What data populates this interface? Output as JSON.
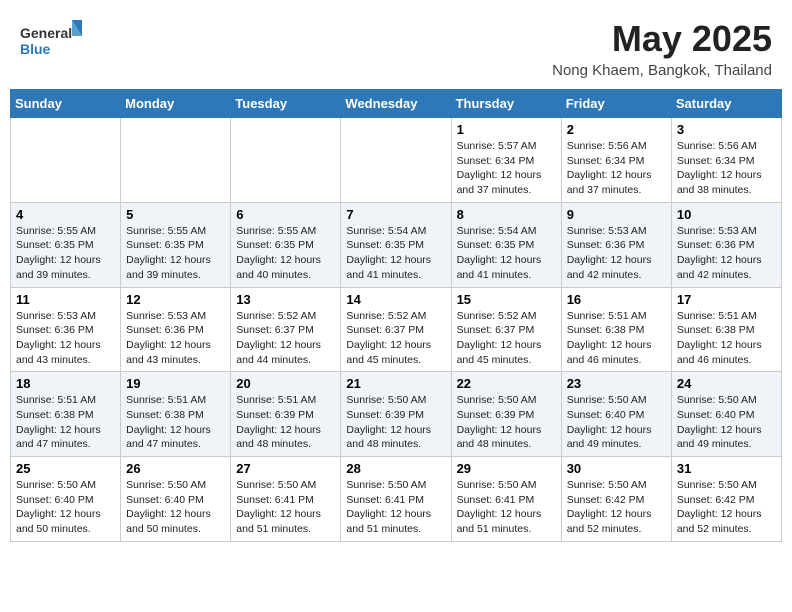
{
  "header": {
    "logo_general": "General",
    "logo_blue": "Blue",
    "month_year": "May 2025",
    "location": "Nong Khaem, Bangkok, Thailand"
  },
  "weekdays": [
    "Sunday",
    "Monday",
    "Tuesday",
    "Wednesday",
    "Thursday",
    "Friday",
    "Saturday"
  ],
  "weeks": [
    [
      {
        "day": "",
        "sunrise": "",
        "sunset": "",
        "daylight": ""
      },
      {
        "day": "",
        "sunrise": "",
        "sunset": "",
        "daylight": ""
      },
      {
        "day": "",
        "sunrise": "",
        "sunset": "",
        "daylight": ""
      },
      {
        "day": "",
        "sunrise": "",
        "sunset": "",
        "daylight": ""
      },
      {
        "day": "1",
        "sunrise": "5:57 AM",
        "sunset": "6:34 PM",
        "daylight": "12 hours and 37 minutes."
      },
      {
        "day": "2",
        "sunrise": "5:56 AM",
        "sunset": "6:34 PM",
        "daylight": "12 hours and 37 minutes."
      },
      {
        "day": "3",
        "sunrise": "5:56 AM",
        "sunset": "6:34 PM",
        "daylight": "12 hours and 38 minutes."
      }
    ],
    [
      {
        "day": "4",
        "sunrise": "5:55 AM",
        "sunset": "6:35 PM",
        "daylight": "12 hours and 39 minutes."
      },
      {
        "day": "5",
        "sunrise": "5:55 AM",
        "sunset": "6:35 PM",
        "daylight": "12 hours and 39 minutes."
      },
      {
        "day": "6",
        "sunrise": "5:55 AM",
        "sunset": "6:35 PM",
        "daylight": "12 hours and 40 minutes."
      },
      {
        "day": "7",
        "sunrise": "5:54 AM",
        "sunset": "6:35 PM",
        "daylight": "12 hours and 41 minutes."
      },
      {
        "day": "8",
        "sunrise": "5:54 AM",
        "sunset": "6:35 PM",
        "daylight": "12 hours and 41 minutes."
      },
      {
        "day": "9",
        "sunrise": "5:53 AM",
        "sunset": "6:36 PM",
        "daylight": "12 hours and 42 minutes."
      },
      {
        "day": "10",
        "sunrise": "5:53 AM",
        "sunset": "6:36 PM",
        "daylight": "12 hours and 42 minutes."
      }
    ],
    [
      {
        "day": "11",
        "sunrise": "5:53 AM",
        "sunset": "6:36 PM",
        "daylight": "12 hours and 43 minutes."
      },
      {
        "day": "12",
        "sunrise": "5:53 AM",
        "sunset": "6:36 PM",
        "daylight": "12 hours and 43 minutes."
      },
      {
        "day": "13",
        "sunrise": "5:52 AM",
        "sunset": "6:37 PM",
        "daylight": "12 hours and 44 minutes."
      },
      {
        "day": "14",
        "sunrise": "5:52 AM",
        "sunset": "6:37 PM",
        "daylight": "12 hours and 45 minutes."
      },
      {
        "day": "15",
        "sunrise": "5:52 AM",
        "sunset": "6:37 PM",
        "daylight": "12 hours and 45 minutes."
      },
      {
        "day": "16",
        "sunrise": "5:51 AM",
        "sunset": "6:38 PM",
        "daylight": "12 hours and 46 minutes."
      },
      {
        "day": "17",
        "sunrise": "5:51 AM",
        "sunset": "6:38 PM",
        "daylight": "12 hours and 46 minutes."
      }
    ],
    [
      {
        "day": "18",
        "sunrise": "5:51 AM",
        "sunset": "6:38 PM",
        "daylight": "12 hours and 47 minutes."
      },
      {
        "day": "19",
        "sunrise": "5:51 AM",
        "sunset": "6:38 PM",
        "daylight": "12 hours and 47 minutes."
      },
      {
        "day": "20",
        "sunrise": "5:51 AM",
        "sunset": "6:39 PM",
        "daylight": "12 hours and 48 minutes."
      },
      {
        "day": "21",
        "sunrise": "5:50 AM",
        "sunset": "6:39 PM",
        "daylight": "12 hours and 48 minutes."
      },
      {
        "day": "22",
        "sunrise": "5:50 AM",
        "sunset": "6:39 PM",
        "daylight": "12 hours and 48 minutes."
      },
      {
        "day": "23",
        "sunrise": "5:50 AM",
        "sunset": "6:40 PM",
        "daylight": "12 hours and 49 minutes."
      },
      {
        "day": "24",
        "sunrise": "5:50 AM",
        "sunset": "6:40 PM",
        "daylight": "12 hours and 49 minutes."
      }
    ],
    [
      {
        "day": "25",
        "sunrise": "5:50 AM",
        "sunset": "6:40 PM",
        "daylight": "12 hours and 50 minutes."
      },
      {
        "day": "26",
        "sunrise": "5:50 AM",
        "sunset": "6:40 PM",
        "daylight": "12 hours and 50 minutes."
      },
      {
        "day": "27",
        "sunrise": "5:50 AM",
        "sunset": "6:41 PM",
        "daylight": "12 hours and 51 minutes."
      },
      {
        "day": "28",
        "sunrise": "5:50 AM",
        "sunset": "6:41 PM",
        "daylight": "12 hours and 51 minutes."
      },
      {
        "day": "29",
        "sunrise": "5:50 AM",
        "sunset": "6:41 PM",
        "daylight": "12 hours and 51 minutes."
      },
      {
        "day": "30",
        "sunrise": "5:50 AM",
        "sunset": "6:42 PM",
        "daylight": "12 hours and 52 minutes."
      },
      {
        "day": "31",
        "sunrise": "5:50 AM",
        "sunset": "6:42 PM",
        "daylight": "12 hours and 52 minutes."
      }
    ]
  ],
  "labels": {
    "sunrise": "Sunrise:",
    "sunset": "Sunset:",
    "daylight": "Daylight:"
  }
}
